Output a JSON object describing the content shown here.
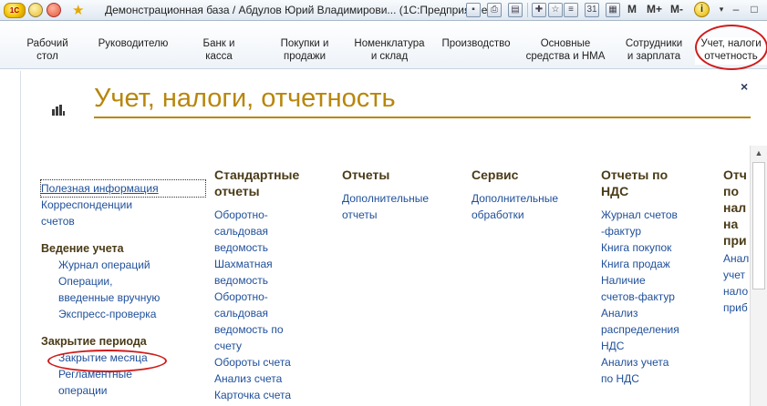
{
  "titlebar": {
    "logo": "1С",
    "title": "Демонстрационная база / Абдулов Юрий Владимирови...  (1С:Предприятие)",
    "m": "M",
    "mplus": "M+",
    "mminus": "M-",
    "info": "i",
    "icons": [
      "save-icon",
      "print-icon",
      "preview-icon",
      "add-favorite-icon",
      "history-icon",
      "calculator-icon",
      "calendar-icon",
      "memory-icon",
      "info-icon",
      "minimize-icon",
      "maximize-icon"
    ]
  },
  "sections": [
    {
      "line1": "Рабочий",
      "line2": "стол"
    },
    {
      "line1": "Руководителю",
      "line2": ""
    },
    {
      "line1": "Банк и",
      "line2": "касса"
    },
    {
      "line1": "Покупки и",
      "line2": "продажи"
    },
    {
      "line1": "Номенклатура",
      "line2": "и склад"
    },
    {
      "line1": "Производство",
      "line2": ""
    },
    {
      "line1": "Основные",
      "line2": "средства и НМА"
    },
    {
      "line1": "Сотрудники",
      "line2": "и зарплата"
    },
    {
      "line1": "Учет, налоги",
      "line2": "отчетность"
    }
  ],
  "page": {
    "title": "Учет, налоги, отчетность",
    "close": "×"
  },
  "left": {
    "useful_info": "Полезная информация",
    "links": [
      "Корреспонденции",
      "счетов"
    ],
    "group1": "Ведение учета",
    "group1_items": [
      "Журнал операций",
      "Операции,",
      "введенные вручную",
      "Экспресс-проверка"
    ],
    "group2": "Закрытие периода",
    "group2_items": [
      "Закрытие месяца",
      "Регламентные",
      "операции"
    ]
  },
  "columns": {
    "standard": {
      "head": [
        "Стандартные",
        "отчеты"
      ],
      "items": [
        "Оборотно-",
        "сальдовая",
        "ведомость",
        "Шахматная",
        "ведомость",
        "Оборотно-",
        "сальдовая",
        "ведомость по",
        "счету",
        "Обороты счета",
        "Анализ счета",
        "Карточка счета"
      ]
    },
    "reports": {
      "head": [
        "Отчеты"
      ],
      "items": [
        "Дополнительные",
        "отчеты"
      ]
    },
    "service": {
      "head": [
        "Сервис"
      ],
      "items": [
        "Дополнительные",
        "обработки"
      ]
    },
    "vat": {
      "head": [
        "Отчеты по",
        "НДС"
      ],
      "items": [
        "Журнал счетов",
        "-фактур",
        "Книга покупок",
        "Книга продаж",
        "Наличие",
        "счетов-фактур",
        "Анализ",
        "распределения",
        "НДС",
        "Анализ учета",
        "по НДС"
      ]
    },
    "profit": {
      "head": [
        "Отч",
        "по",
        "нал",
        "на",
        "при"
      ],
      "items": [
        "Анал",
        "учет",
        "нало",
        "приб"
      ]
    }
  }
}
